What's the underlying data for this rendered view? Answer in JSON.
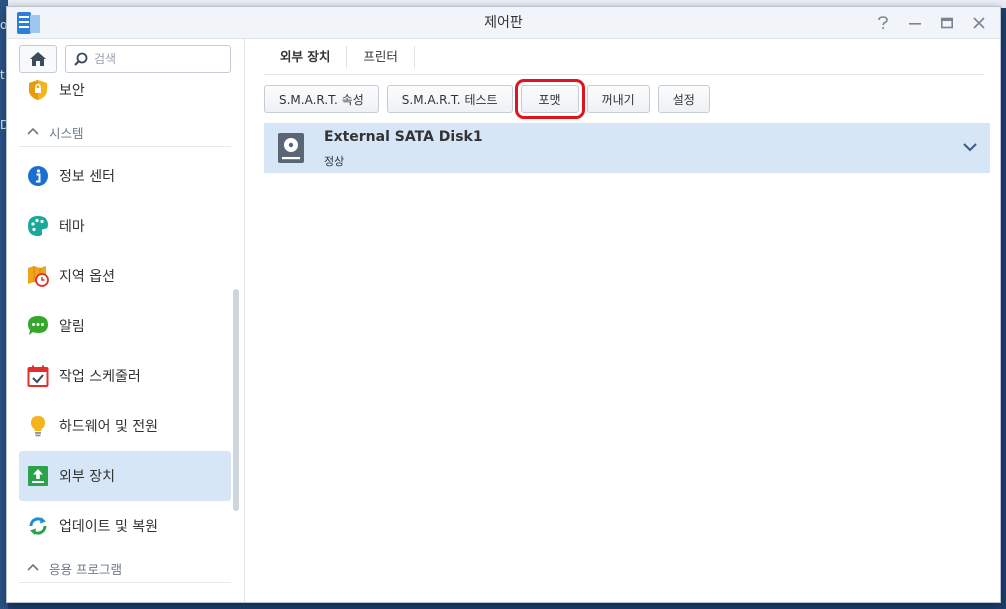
{
  "window": {
    "title": "제어판"
  },
  "background": {
    "left_chars": [
      "o",
      "t",
      "D"
    ]
  },
  "sidebar": {
    "search_placeholder": "검색",
    "items_top": [
      {
        "label": "보안",
        "icon": "shield-icon"
      }
    ],
    "section_system": "시스템",
    "items": [
      {
        "label": "정보 센터",
        "icon": "info-icon"
      },
      {
        "label": "테마",
        "icon": "palette-icon"
      },
      {
        "label": "지역 옵션",
        "icon": "map-clock-icon"
      },
      {
        "label": "알림",
        "icon": "chat-bubble-icon"
      },
      {
        "label": "작업 스케줄러",
        "icon": "calendar-check-icon"
      },
      {
        "label": "하드웨어 및 전원",
        "icon": "lightbulb-icon"
      },
      {
        "label": "외부 장치",
        "icon": "external-device-icon",
        "active": true
      },
      {
        "label": "업데이트 및 복원",
        "icon": "refresh-icon"
      }
    ],
    "section_apps": "응용 프로그램"
  },
  "main": {
    "tabs": [
      {
        "label": "외부 장치",
        "active": true
      },
      {
        "label": "프린터",
        "active": false
      }
    ],
    "toolbar": {
      "smart_attr": "S.M.A.R.T. 속성",
      "smart_test": "S.M.A.R.T. 테스트",
      "format": "포맷",
      "eject": "꺼내기",
      "settings": "설정"
    },
    "device": {
      "name": "External SATA Disk1",
      "status": "정상"
    }
  },
  "colors": {
    "accent_selected": "#d6e6f7",
    "highlight_box": "#e0141e"
  }
}
